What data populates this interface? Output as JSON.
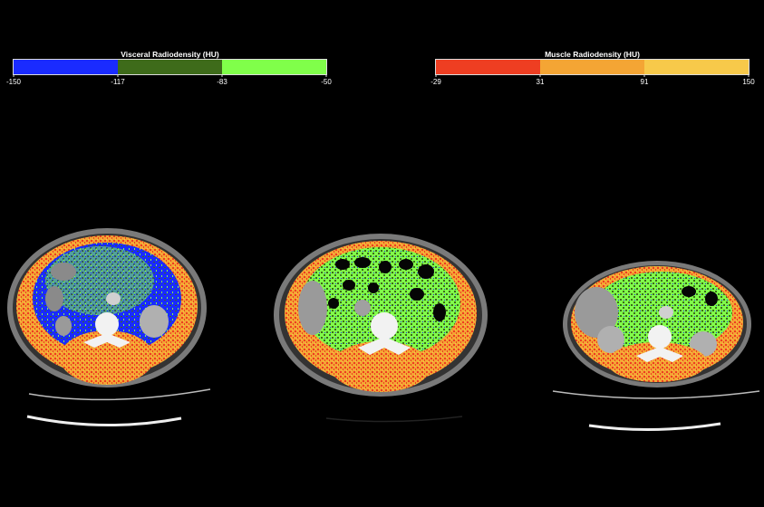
{
  "legends": [
    {
      "title": "Visceral Radiodensity (HU)",
      "colors": [
        "#1a2bff",
        "#3e6b1a",
        "#80ff4a"
      ],
      "ticks": [
        "-150",
        "-117",
        "-83",
        "-50"
      ]
    },
    {
      "title": "Muscle Radiodensity (HU)",
      "colors": [
        "#ee3e22",
        "#f4a534",
        "#f7c94a"
      ],
      "ticks": [
        "-29",
        "31",
        "91",
        "150"
      ]
    }
  ],
  "colors": {
    "background": "#000000",
    "skin": "#8a8a8a",
    "body": "#3a3a3a",
    "bone": "#f2f2f2",
    "organ": "#9a9a9a",
    "bowel_gas": "#050505",
    "visceral_low": "#1a2bff",
    "visceral_mid": "#3e6b1a",
    "visceral_high": "#80ff4a",
    "muscle_low": "#ee3e22",
    "muscle_mid": "#f4a534",
    "muscle_high": "#f7c94a"
  },
  "scans": [
    {
      "label": "scan-left"
    },
    {
      "label": "scan-middle"
    },
    {
      "label": "scan-right"
    }
  ]
}
